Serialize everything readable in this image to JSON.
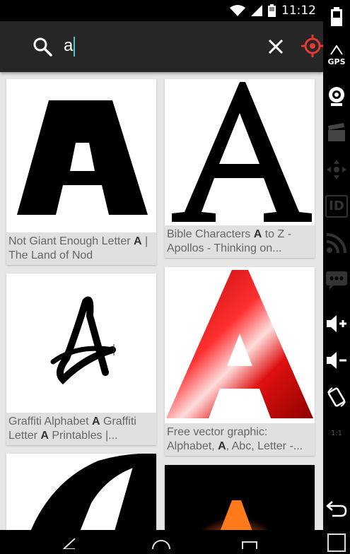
{
  "status": {
    "time": "11:12"
  },
  "search": {
    "query": "a"
  },
  "results": [
    {
      "title_pre": "Not Giant Enough Letter ",
      "title_bold": "A",
      "title_post": " | The Land of Nod"
    },
    {
      "title_pre": "Bible Characters ",
      "title_bold": "A",
      "title_post": " to Z - Apollos - Thinking on..."
    },
    {
      "title_pre": "Graffiti Alphabet ",
      "title_bold": "A",
      "title_mid": " Graffiti Letter ",
      "title_bold2": "A",
      "title_post": " Printables |..."
    },
    {
      "title_pre": "Free vector graphic: Alphabet, ",
      "title_bold": "A",
      "title_post": ", Abc, Letter -..."
    }
  ],
  "sidebar": {
    "gps_label": "GPS",
    "id_label": "ID",
    "scale_label": "1:1"
  },
  "icons": {
    "search": "search-icon",
    "clear": "close-icon",
    "target": "target-icon",
    "back": "back-icon",
    "home": "home-icon",
    "recents": "recents-icon"
  },
  "colors": {
    "accent": "#4fc3c7",
    "target": "#e53935",
    "red_letter": "#d81e1e"
  }
}
